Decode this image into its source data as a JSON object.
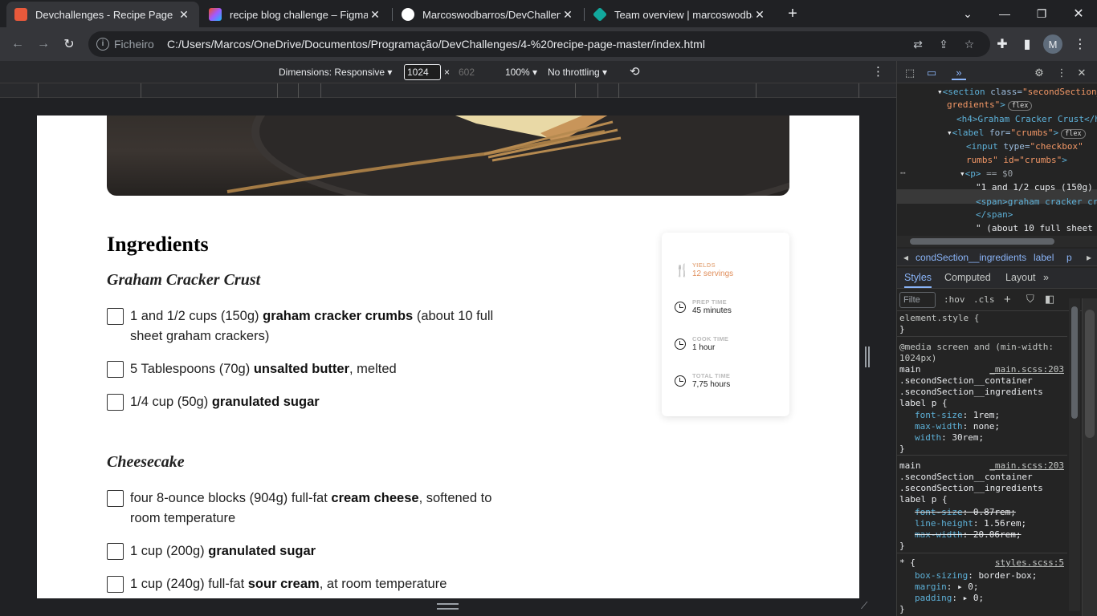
{
  "browser": {
    "tabs": [
      {
        "title": "Devchallenges - Recipe Page",
        "favicon_color": "#e8593b",
        "active": true
      },
      {
        "title": "recipe blog challenge – Figma",
        "favicon_color": "#a259ff",
        "active": false
      },
      {
        "title": "Marcoswodbarros/DevChallenges",
        "favicon_color": "#ffffff",
        "active": false
      },
      {
        "title": "Team overview | marcoswodbarros",
        "favicon_color": "#12a89d",
        "active": false
      }
    ],
    "new_tab": "+",
    "omnibox": {
      "scheme": "Ficheiro",
      "url": "C:/Users/Marcos/OneDrive/Documentos/Programação/DevChallenges/4-%20recipe-page-master/index.html"
    },
    "profile_initial": "M"
  },
  "device_toolbar": {
    "dimensions": "Dimensions: Responsive ▾",
    "width": "1024",
    "times": "×",
    "height": "602",
    "zoom": "100% ▾",
    "throttling": "No throttling ▾"
  },
  "recipe": {
    "section_title": "Ingredients",
    "groups": [
      {
        "title": "Graham Cracker Crust",
        "items": [
          {
            "pre": "1 and 1/2 cups (150g) ",
            "bold": "graham cracker crumbs",
            "post": " (about 10 full sheet graham crackers)"
          },
          {
            "pre": "5 Tablespoons (70g) ",
            "bold": "unsalted butter",
            "post": ", melted"
          },
          {
            "pre": "1/4 cup (50g) ",
            "bold": "granulated sugar",
            "post": ""
          }
        ]
      },
      {
        "title": "Cheesecake",
        "items": [
          {
            "pre": "four 8-ounce blocks (904g) full-fat ",
            "bold": "cream cheese",
            "post": ", softened to room temperature"
          },
          {
            "pre": "1 cup (200g) ",
            "bold": "granulated sugar",
            "post": ""
          },
          {
            "pre": "1 cup (240g) full-fat ",
            "bold": "sour cream",
            "post": ", at room temperature"
          }
        ]
      }
    ],
    "info": [
      {
        "label": "YIELDS",
        "value": "12 servings",
        "icon": "fork-knife-icon",
        "accent": "#e08e5b"
      },
      {
        "label": "PREP TIME",
        "value": "45 minutes",
        "icon": "clock-icon"
      },
      {
        "label": "COOK TIME",
        "value": "1 hour",
        "icon": "clock-icon"
      },
      {
        "label": "TOTAL TIME",
        "value": "7,75 hours",
        "icon": "clock-icon"
      }
    ]
  },
  "devtools": {
    "dom": {
      "l1_tag": "<section",
      "l1_attr": " class=",
      "l1_val": "\"secondSection__in",
      "l2_val": "gredients\"",
      "l2_end": ">",
      "l2_pill": "flex",
      "l3": "<h4>Graham Cracker Crust</h4>",
      "l4_tag": "<label",
      "l4_attr": " for=",
      "l4_val": "\"crumbs\"",
      "l4_end": ">",
      "l4_pill": "flex",
      "l5_tag": "<input",
      "l5_attr": " type=",
      "l5_val": "\"checkbox\"",
      "l6_val": "rumbs\" id=\"crumbs\"",
      "l6_end": ">",
      "l7_tag": "<p>",
      "l7_rest": " == $0",
      "l8": "\"1 and 1/2 cups (150g) \"",
      "l9": "<span>graham cracker crumbs",
      "l10": "</span>",
      "l11": "\" (about 10 full sheet"
    },
    "breadcrumbs": [
      "condSection__ingredients",
      "label",
      "p"
    ],
    "style_tabs": [
      "Styles",
      "Computed",
      "Layout"
    ],
    "filter_placeholder": "Filte",
    "filter_buttons": [
      ":hov",
      ".cls"
    ],
    "rules": {
      "element_style": "element.style {",
      "close": "}",
      "media": "@media screen and (min-width:",
      "media2": "1024px)",
      "sel_main": "main",
      "src1": "_main.scss:203",
      "sel2": ".secondSection__container",
      "sel3": ".secondSection__ingredients",
      "sel4": "label p {",
      "p1_name": "font-size",
      "p1_val": ": 1rem;",
      "p2_name": "max-width",
      "p2_val": ": none;",
      "p3_name": "width",
      "p3_val": ": 30rem;",
      "src2": "_main.scss:203",
      "p4_name": "font-size",
      "p4_val": ": 0.87rem;",
      "p5_name": "line-height",
      "p5_val": ": 1.56rem;",
      "p6_name": "max-width",
      "p6_val": ": 20.06rem;",
      "sel_star": "* {",
      "src3": "styles.scss:5",
      "p7_name": "box-sizing",
      "p7_val": ": border-box;",
      "p8_name": "margin",
      "p8_val": ": ▸ 0;",
      "p9_name": "padding",
      "p9_val": ": ▸ 0;"
    }
  }
}
